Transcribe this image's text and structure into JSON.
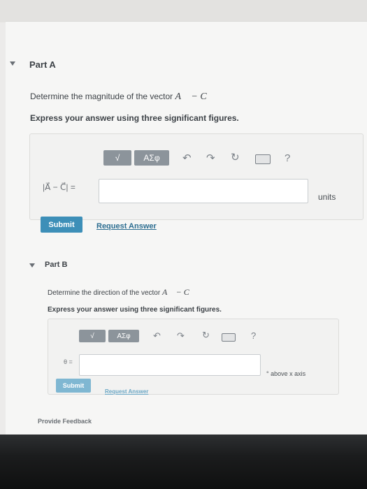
{
  "partA": {
    "title": "Part A",
    "question_prefix": "Determine the magnitude of the vector ",
    "vector_expr": "A⃗ − C⃗",
    "instruction": "Express your answer using three significant figures.",
    "toolbar": {
      "matrix_label": "√",
      "greek_label": "ΑΣφ",
      "help_label": "?"
    },
    "answer_label": "|A⃗ − C⃗| =",
    "answer_value": "",
    "units_placeholder": "units",
    "submit_label": "Submit",
    "request_answer_label": "Request Answer"
  },
  "partB": {
    "title": "Part B",
    "question_prefix": "Determine the direction of the vector ",
    "vector_expr": "A⃗ − C⃗",
    "instruction": "Express your answer using three significant figures.",
    "toolbar": {
      "matrix_label": "√",
      "greek_label": "ΑΣφ",
      "help_label": "?"
    },
    "answer_label": "θ =",
    "answer_value": "",
    "units_text": "° above x axis",
    "submit_label": "Submit",
    "request_answer_label": "Request Answer"
  },
  "footer": {
    "provide_feedback": "Provide Feedback"
  }
}
